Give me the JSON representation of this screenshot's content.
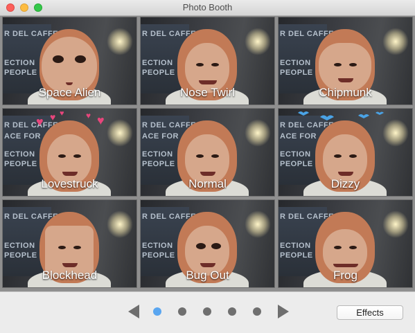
{
  "window": {
    "title": "Photo Booth"
  },
  "effects": [
    {
      "label": "Space Alien",
      "key": "space-alien"
    },
    {
      "label": "Nose Twirl",
      "key": "nose-twirl"
    },
    {
      "label": "Chipmunk",
      "key": "chipmunk"
    },
    {
      "label": "Lovestruck",
      "key": "lovestruck"
    },
    {
      "label": "Normal",
      "key": "normal"
    },
    {
      "label": "Dizzy",
      "key": "dizzy"
    },
    {
      "label": "Blockhead",
      "key": "blockhead"
    },
    {
      "label": "Bug Out",
      "key": "bug-out"
    },
    {
      "label": "Frog",
      "key": "frog"
    }
  ],
  "background_text": {
    "line1": "R DEL CAFFE",
    "line2": "ACE FOR",
    "line3": "ECTION",
    "line4": "PEOPLE"
  },
  "pager": {
    "page_count": 5,
    "current_page": 1
  },
  "effects_button": {
    "label": "Effects"
  },
  "colors": {
    "active_dot": "#5aa6f0",
    "inactive_dot": "#6f6f6f",
    "hearts": "#e8467c",
    "birds": "#4aa3e6"
  },
  "icons": {
    "prev": "left-triangle",
    "next": "right-triangle",
    "heart": "♥",
    "bird": "bird-silhouette"
  }
}
